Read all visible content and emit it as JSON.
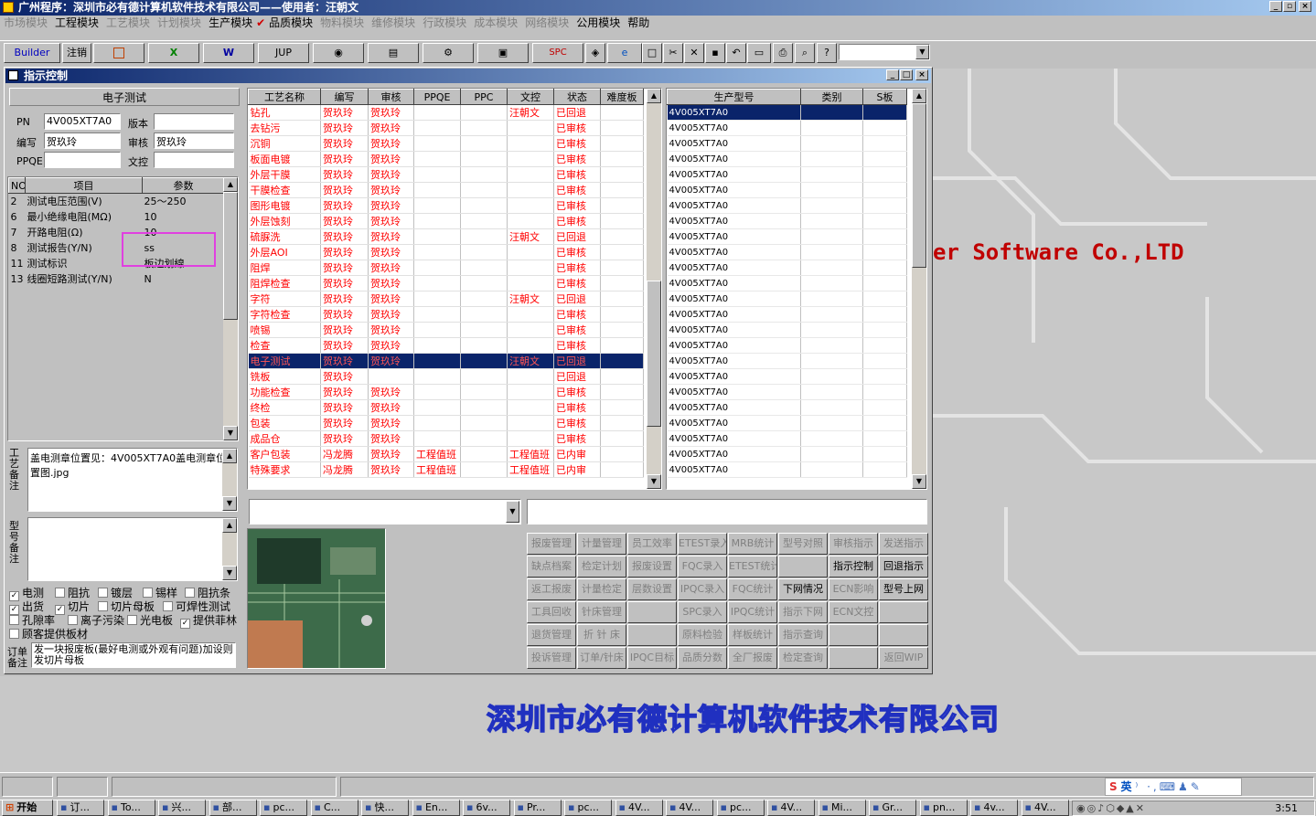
{
  "app": {
    "title": "广州程序：深圳市必有德计算机软件技术有限公司——使用者：汪朝文"
  },
  "menu": [
    {
      "label": "市场模块",
      "dim": true
    },
    {
      "label": "工程模块",
      "dim": false
    },
    {
      "label": "工艺模块",
      "dim": true
    },
    {
      "label": "计划模块",
      "dim": true
    },
    {
      "label": "生产模块",
      "dim": false
    },
    {
      "label": "品质模块",
      "dim": false
    },
    {
      "label": "物料模块",
      "dim": true
    },
    {
      "label": "维修模块",
      "dim": true
    },
    {
      "label": "行政模块",
      "dim": true
    },
    {
      "label": "成本模块",
      "dim": true
    },
    {
      "label": "网络模块",
      "dim": true
    },
    {
      "label": "公用模块",
      "dim": false
    },
    {
      "label": "帮助",
      "dim": false
    }
  ],
  "toolbar": {
    "builder": "Builder",
    "logout": "注销",
    "jup": "JUP",
    "spc": "SPC"
  },
  "background": {
    "software_text": "er Software Co.,LTD",
    "company_banner": "深圳市必有德计算机软件技术有限公司"
  },
  "window": {
    "title": "指示控制"
  },
  "left": {
    "section_title": "电子测试",
    "pn_label": "PN",
    "pn_value": "4V005XT7A0",
    "version_label": "版本",
    "version_value": "",
    "author_label": "编写",
    "author_value": "贺玖玲",
    "review_label": "审核",
    "review_value": "贺玖玲",
    "ppqe_label": "PPQE",
    "ppqe_value": "",
    "control_label": "文控",
    "control_value": "",
    "params_headers": [
      "NO",
      "项目",
      "参数"
    ],
    "params": [
      {
        "no": "2",
        "item": "测试电压范围(V)",
        "value": "25～250"
      },
      {
        "no": "6",
        "item": "最小绝缘电阻(MΩ)",
        "value": "10"
      },
      {
        "no": "7",
        "item": "开路电阻(Ω)",
        "value": "10"
      },
      {
        "no": "8",
        "item": "测试报告(Y/N)",
        "value": "ss"
      },
      {
        "no": "11",
        "item": "测试标识",
        "value": "板边划線"
      },
      {
        "no": "13",
        "item": "线圈短路测试(Y/N)",
        "value": "N"
      }
    ],
    "process_note_label": "工艺备注",
    "process_note": "盖电测章位置见：4V005XT7A0盖电测章位置图.jpg",
    "model_note_label": "型号备注",
    "model_note": "",
    "checkboxes": [
      [
        {
          "label": "电测",
          "checked": true
        },
        {
          "label": "阻抗",
          "checked": false
        },
        {
          "label": "镀层",
          "checked": false
        },
        {
          "label": "锡样",
          "checked": false
        },
        {
          "label": "阻抗条",
          "checked": false
        }
      ],
      [
        {
          "label": "出货",
          "checked": true
        },
        {
          "label": "切片",
          "checked": true
        },
        {
          "label": "切片母板",
          "checked": false
        },
        {
          "label": "可焊性测试",
          "checked": false
        }
      ],
      [
        {
          "label": "孔隙率",
          "checked": false
        },
        {
          "label": "离子污染",
          "checked": false
        },
        {
          "label": "光电板",
          "checked": false
        },
        {
          "label": "提供菲林",
          "checked": true
        }
      ],
      [
        {
          "label": "顾客提供板材",
          "checked": false
        }
      ]
    ],
    "order_note_label": "订单备注",
    "order_note": "发一块报废板(最好电测或外观有问题)加设则发切片母板"
  },
  "process": {
    "headers": [
      "工艺名称",
      "编写",
      "审核",
      "PPQE",
      "PPC",
      "文控",
      "状态",
      "难度板"
    ],
    "rows": [
      [
        "钻孔",
        "贺玖玲",
        "贺玖玲",
        "",
        "",
        "汪朝文",
        "已回退",
        ""
      ],
      [
        "去钻污",
        "贺玖玲",
        "贺玖玲",
        "",
        "",
        "",
        "已审核",
        ""
      ],
      [
        "沉铜",
        "贺玖玲",
        "贺玖玲",
        "",
        "",
        "",
        "已审核",
        ""
      ],
      [
        "板面电镀",
        "贺玖玲",
        "贺玖玲",
        "",
        "",
        "",
        "已审核",
        ""
      ],
      [
        "外层干膜",
        "贺玖玲",
        "贺玖玲",
        "",
        "",
        "",
        "已审核",
        ""
      ],
      [
        "干膜检查",
        "贺玖玲",
        "贺玖玲",
        "",
        "",
        "",
        "已审核",
        ""
      ],
      [
        "图形电镀",
        "贺玖玲",
        "贺玖玲",
        "",
        "",
        "",
        "已审核",
        ""
      ],
      [
        "外层蚀刻",
        "贺玖玲",
        "贺玖玲",
        "",
        "",
        "",
        "已审核",
        ""
      ],
      [
        "硫脲洗",
        "贺玖玲",
        "贺玖玲",
        "",
        "",
        "汪朝文",
        "已回退",
        ""
      ],
      [
        "外层AOI",
        "贺玖玲",
        "贺玖玲",
        "",
        "",
        "",
        "已审核",
        ""
      ],
      [
        "阻焊",
        "贺玖玲",
        "贺玖玲",
        "",
        "",
        "",
        "已审核",
        ""
      ],
      [
        "阻焊检查",
        "贺玖玲",
        "贺玖玲",
        "",
        "",
        "",
        "已审核",
        ""
      ],
      [
        "字符",
        "贺玖玲",
        "贺玖玲",
        "",
        "",
        "汪朝文",
        "已回退",
        ""
      ],
      [
        "字符检查",
        "贺玖玲",
        "贺玖玲",
        "",
        "",
        "",
        "已审核",
        ""
      ],
      [
        "喷锡",
        "贺玖玲",
        "贺玖玲",
        "",
        "",
        "",
        "已审核",
        ""
      ],
      [
        "检查",
        "贺玖玲",
        "贺玖玲",
        "",
        "",
        "",
        "已审核",
        ""
      ],
      [
        "电子测试",
        "贺玖玲",
        "贺玖玲",
        "",
        "",
        "汪朝文",
        "已回退",
        ""
      ],
      [
        "铣板",
        "贺玖玲",
        "",
        "",
        "",
        "",
        "已回退",
        ""
      ],
      [
        "功能检查",
        "贺玖玲",
        "贺玖玲",
        "",
        "",
        "",
        "已审核",
        ""
      ],
      [
        "终检",
        "贺玖玲",
        "贺玖玲",
        "",
        "",
        "",
        "已审核",
        ""
      ],
      [
        "包装",
        "贺玖玲",
        "贺玖玲",
        "",
        "",
        "",
        "已审核",
        ""
      ],
      [
        "成品仓",
        "贺玖玲",
        "贺玖玲",
        "",
        "",
        "",
        "已审核",
        ""
      ],
      [
        "客户包装",
        "冯龙腾",
        "贺玖玲",
        "工程值班",
        "",
        "工程值班",
        "已内审",
        ""
      ],
      [
        "特殊要求",
        "冯龙腾",
        "贺玖玲",
        "工程值班",
        "",
        "工程值班",
        "已内审",
        ""
      ]
    ],
    "selected_index": 16
  },
  "models": {
    "headers": [
      "生产型号",
      "类别",
      "S板"
    ],
    "rows": [
      "4V005XT7A0",
      "4V005XT7A0",
      "4V005XT7A0",
      "4V005XT7A0",
      "4V005XT7A0",
      "4V005XT7A0",
      "4V005XT7A0",
      "4V005XT7A0",
      "4V005XT7A0",
      "4V005XT7A0",
      "4V005XT7A0",
      "4V005XT7A0",
      "4V005XT7A0",
      "4V005XT7A0",
      "4V005XT7A0",
      "4V005XT7A0",
      "4V005XT7A0",
      "4V005XT7A0",
      "4V005XT7A0",
      "4V005XT7A0",
      "4V005XT7A0",
      "4V005XT7A0",
      "4V005XT7A0",
      "4V005XT7A0"
    ],
    "selected_index": 0
  },
  "functions": [
    [
      {
        "label": "报废管理",
        "on": false
      },
      {
        "label": "计量管理",
        "on": false
      },
      {
        "label": "员工效率",
        "on": false
      },
      {
        "label": "ETEST录入",
        "on": false
      },
      {
        "label": "MRB统计",
        "on": false
      },
      {
        "label": "型号对照",
        "on": false
      },
      {
        "label": "审核指示",
        "on": false
      },
      {
        "label": "发送指示",
        "on": false
      }
    ],
    [
      {
        "label": "缺点档案",
        "on": false
      },
      {
        "label": "检定计划",
        "on": false
      },
      {
        "label": "报废设置",
        "on": false
      },
      {
        "label": "FQC录入",
        "on": false
      },
      {
        "label": "ETEST统计",
        "on": false
      },
      {
        "label": "",
        "on": false
      },
      {
        "label": "指示控制",
        "on": true
      },
      {
        "label": "回退指示",
        "on": true
      }
    ],
    [
      {
        "label": "返工报废",
        "on": false
      },
      {
        "label": "计量检定",
        "on": false
      },
      {
        "label": "层数设置",
        "on": false
      },
      {
        "label": "IPQC录入",
        "on": false
      },
      {
        "label": "FQC统计",
        "on": false
      },
      {
        "label": "下网情况",
        "on": true
      },
      {
        "label": "ECN影响",
        "on": false
      },
      {
        "label": "型号上网",
        "on": true
      }
    ],
    [
      {
        "label": "工具回收",
        "on": false
      },
      {
        "label": "针床管理",
        "on": false
      },
      {
        "label": "",
        "on": false
      },
      {
        "label": "SPC录入",
        "on": false
      },
      {
        "label": "IPQC统计",
        "on": false
      },
      {
        "label": "指示下网",
        "on": false
      },
      {
        "label": "ECN文控",
        "on": false
      },
      {
        "label": "",
        "on": false
      }
    ],
    [
      {
        "label": "退货管理",
        "on": false
      },
      {
        "label": "折 针 床",
        "on": false
      },
      {
        "label": "",
        "on": false
      },
      {
        "label": "原料检验",
        "on": false
      },
      {
        "label": "样板统计",
        "on": false
      },
      {
        "label": "指示查询",
        "on": false
      },
      {
        "label": "",
        "on": false
      },
      {
        "label": "",
        "on": false
      }
    ],
    [
      {
        "label": "投诉管理",
        "on": false
      },
      {
        "label": "订单/针床",
        "on": false
      },
      {
        "label": "IPQC目标",
        "on": false
      },
      {
        "label": "品质分数",
        "on": false
      },
      {
        "label": "全厂报废",
        "on": false
      },
      {
        "label": "检定查询",
        "on": false
      },
      {
        "label": "",
        "on": false
      },
      {
        "label": "返回WIP",
        "on": false
      }
    ]
  ],
  "taskbar": {
    "start": "开始",
    "items": [
      "订...",
      "To...",
      "兴...",
      "部...",
      "pc...",
      "C...",
      "快...",
      "En...",
      "6v...",
      "Pr...",
      "pc...",
      "4V...",
      "4V...",
      "pc...",
      "4V...",
      "Mi...",
      "Gr...",
      "pn...",
      "4v...",
      "4V..."
    ],
    "clock": "3:51",
    "ime": "英"
  },
  "colors": {
    "titlebar": "#0a246a",
    "selection": "#0a246a",
    "accent_red": "#ff0000",
    "magenta_highlight": "#e040e0"
  }
}
